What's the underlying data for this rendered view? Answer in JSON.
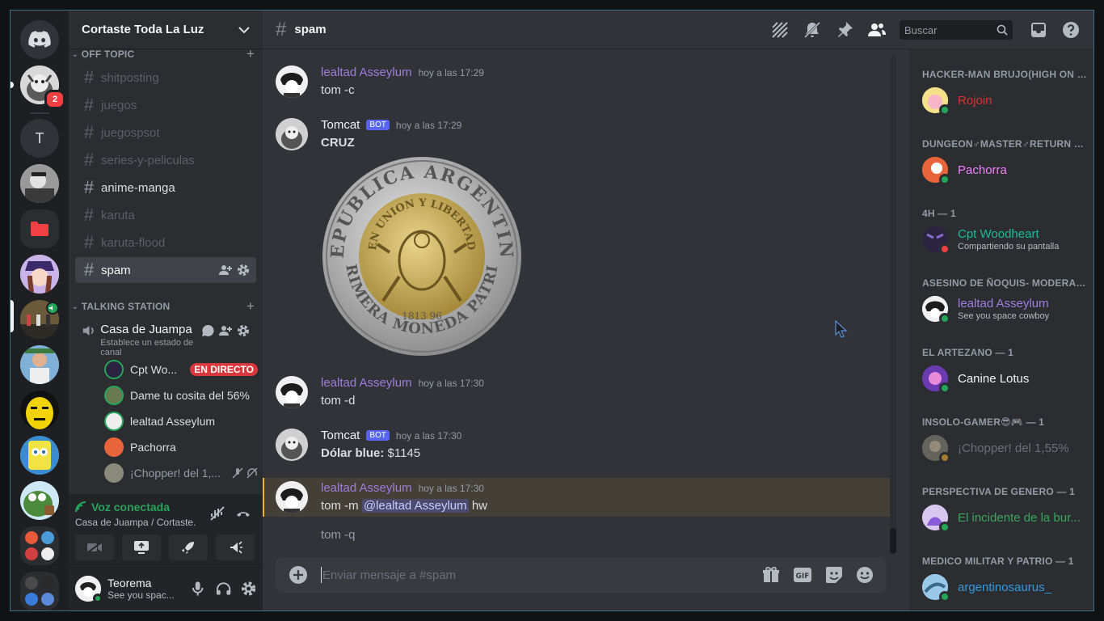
{
  "rail": {
    "badge": "2",
    "text_server": "T"
  },
  "guild": {
    "name": "Cortaste Toda La Luz"
  },
  "categories": {
    "off_topic": "OFF TOPIC",
    "talking": "TALKING STATION"
  },
  "channels": [
    "shitposting",
    "juegos",
    "juegospsot",
    "series-y-peliculas",
    "anime-manga",
    "karuta",
    "karuta-flood",
    "spam"
  ],
  "voice": {
    "channel": "Casa de Juampa",
    "status": "Establece un estado de canal",
    "users": [
      "Cpt Wo...",
      "Dame tu cosita del 56%",
      "lealtad Asseylum",
      "Pachorra",
      "¡Chopper! del 1,..."
    ],
    "live": "EN DIRECTO",
    "connected": "Voz conectada",
    "location": "Casa de Juampa / Cortaste..."
  },
  "user": {
    "name": "Teorema",
    "status": "See you spac..."
  },
  "header": {
    "channel": "spam",
    "search_placeholder": "Buscar"
  },
  "messages": [
    {
      "author": "lealtad Asseylum",
      "time": "hoy a las 17:29",
      "text": "tom -c"
    },
    {
      "author": "Tomcat",
      "bot": "BOT",
      "time": "hoy a las 17:29",
      "text": "CRUZ"
    },
    {
      "author": "lealtad Asseylum",
      "time": "hoy a las 17:30",
      "text": "tom -d"
    },
    {
      "author": "Tomcat",
      "bot": "BOT",
      "time": "hoy a las 17:30",
      "label": "Dólar blue:",
      "value": "$1145"
    },
    {
      "author": "lealtad Asseylum",
      "time": "hoy a las 17:30",
      "text_prefix": "tom -m",
      "mention": "@lealtad Asseylum",
      "text_suffix": "hw"
    },
    {
      "text": "tom -q"
    }
  ],
  "coin": {
    "top": "REPUBLICA ARGENTINA",
    "inner": "EN UNION Y LIBERTAD",
    "bottom": "PRIMERA MONEDA PATRIA",
    "year": "1813  96"
  },
  "composer": {
    "placeholder": "Enviar mensaje a #spam"
  },
  "members": [
    {
      "role": "HACKER-MAN BRUJO(HIGH ON DU...",
      "name": "Rojoin",
      "color": "#e03131"
    },
    {
      "role": "DUNGEON♂MASTER♂RETURN — 1",
      "name": "Pachorra",
      "color": "#f47fff"
    },
    {
      "role": "4H — 1",
      "name": "Cpt Woodheart",
      "sub": "Compartiendo su pantalla",
      "color": "#1abc9c"
    },
    {
      "role": "ASESINO DE ÑOQUIS- MODERADO...",
      "name": "lealtad Asseylum",
      "sub": "See you space cowboy",
      "color": "#a07ce0"
    },
    {
      "role": "EL ARTEZANO — 1",
      "name": "Canine Lotus",
      "color": "#f2f3f5"
    },
    {
      "role": "INSOLO-GAMER😎🎮 — 1",
      "name": "¡Chopper! del 1,55%",
      "color": "#6b6f77"
    },
    {
      "role": "PERSPECTIVA DE GENERO — 1",
      "name": "El incidente de la bur...",
      "color": "#3ba55c"
    },
    {
      "role": "MEDICO MILITAR Y PATRIO — 1",
      "name": "argentinosaurus_",
      "color": "#3498db"
    }
  ]
}
